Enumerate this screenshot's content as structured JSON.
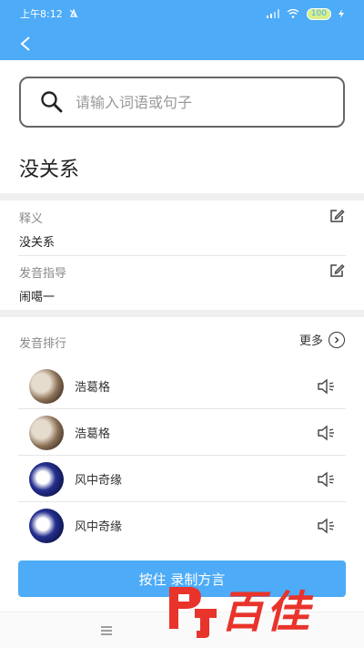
{
  "status_bar": {
    "time": "上午8:12",
    "battery": "100"
  },
  "search": {
    "placeholder": "请输入词语或句子"
  },
  "word": {
    "title": "没关系"
  },
  "definition": {
    "label": "释义",
    "value": "没关系"
  },
  "pronunciation": {
    "label": "发音指导",
    "value": "闹噶一"
  },
  "ranking": {
    "label": "发音排行",
    "more": "更多",
    "items": [
      {
        "name": "浩葛格"
      },
      {
        "name": "浩葛格"
      },
      {
        "name": "风中奇缘"
      },
      {
        "name": "风中奇缘"
      }
    ]
  },
  "record_button": {
    "label": "按住 录制方言"
  },
  "watermark": {
    "text": "百佳"
  },
  "colors": {
    "primary": "#4dabf7",
    "watermark": "#e8342b"
  }
}
